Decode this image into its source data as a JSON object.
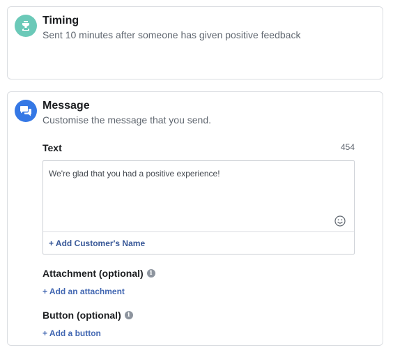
{
  "timing": {
    "title": "Timing",
    "description": "Sent 10 minutes after someone has given positive feedback",
    "icon": "timer-icon",
    "icon_color": "#6bc9b8"
  },
  "message": {
    "title": "Message",
    "description": "Customise the message that you send.",
    "icon": "chat-bubbles-icon",
    "icon_color": "#3578e5",
    "text_label": "Text",
    "char_count": "454",
    "text_value": "We're glad that you had a positive experience!",
    "add_name_label": "+ Add Customer's Name",
    "attachment_label": "Attachment (optional)",
    "add_attachment_label": "+ Add an attachment",
    "button_label": "Button (optional)",
    "add_button_label": "+ Add a button",
    "link_color": "#4267b2"
  }
}
